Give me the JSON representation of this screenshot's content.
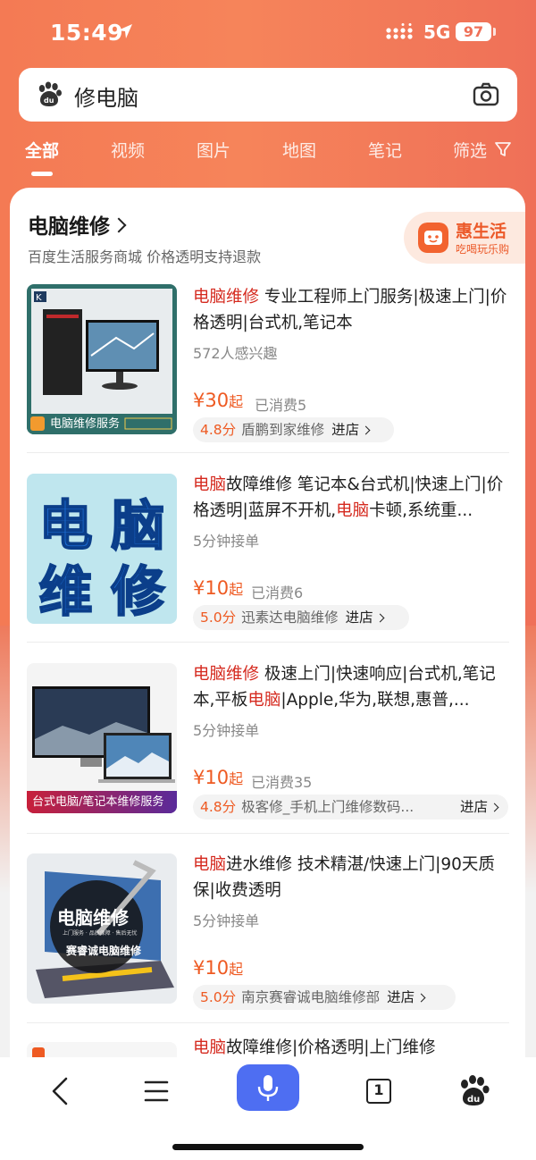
{
  "status": {
    "time": "15:49",
    "network": "5G",
    "battery": "97"
  },
  "search": {
    "query": "修电脑"
  },
  "tabs": [
    "全部",
    "视频",
    "图片",
    "地图",
    "笔记",
    "筛选"
  ],
  "card": {
    "title": "电脑维修",
    "subtitle": "百度生活服务商城 价格透明支持退款",
    "badge_title": "惠生活",
    "badge_sub": "吃喝玩乐购"
  },
  "items": [
    {
      "title_hl": "电脑维修",
      "title_rest": " 专业工程师上门服务|极速上门|价格透明|台式机,笔记本",
      "meta": "572人感兴趣",
      "price_symbol": "¥",
      "price_value": "30",
      "price_suffix": "起",
      "sold": "已消费5",
      "score": "4.8分",
      "store": "盾鹏到家维修",
      "enter": "进店",
      "thumb_caption": "电脑维修服务"
    },
    {
      "title_hl": "电脑",
      "title_mid": "故障维修 笔记本&台式机|快速上门|价格透明|蓝屏不开机,",
      "title_hl2": "电脑",
      "title_rest": "卡顿,系统重...",
      "meta": "5分钟接单",
      "price_symbol": "¥",
      "price_value": "10",
      "price_suffix": "起",
      "sold": "已消费6",
      "score": "5.0分",
      "store": "迅素达电脑维修",
      "enter": "进店",
      "thumb_text1": "电 脑",
      "thumb_text2": "维 修"
    },
    {
      "title_hl": "电脑维修",
      "title_mid": " 极速上门|快速响应|台式机,笔记本,平板",
      "title_hl2": "电脑",
      "title_rest": "|Apple,华为,联想,惠普,...",
      "meta": "5分钟接单",
      "price_symbol": "¥",
      "price_value": "10",
      "price_suffix": "起",
      "sold": "已消费35",
      "score": "4.8分",
      "store": "极客修_手机上门维修数码...",
      "enter": "进店",
      "thumb_caption": "台式电脑/笔记本维修服务"
    },
    {
      "title_hl": "电脑",
      "title_rest": "进水维修 技术精湛/快速上门|90天质保|收费透明",
      "meta": "5分钟接单",
      "price_symbol": "¥",
      "price_value": "10",
      "price_suffix": "起",
      "score": "5.0分",
      "store": "南京赛睿诚电脑维修部",
      "enter": "进店",
      "thumb_text1": "电脑维修",
      "thumb_text2": "上门服务 · 品质保障 · 售后无忧",
      "thumb_text3": "赛睿诚电脑维修"
    },
    {
      "title_hl": "电脑",
      "title_rest": "故障维修|价格透明|上门维修"
    }
  ],
  "colors": {
    "accent": "#f47a54",
    "highlight": "#d52a1f",
    "price": "#ee5a22",
    "mic": "#4e6ef2"
  },
  "bottom_nav": [
    "back-icon",
    "menu-icon",
    "mic-icon",
    "tabs-count-icon",
    "baidu-paw-icon"
  ],
  "bottom_nav_tabs_count": "1"
}
